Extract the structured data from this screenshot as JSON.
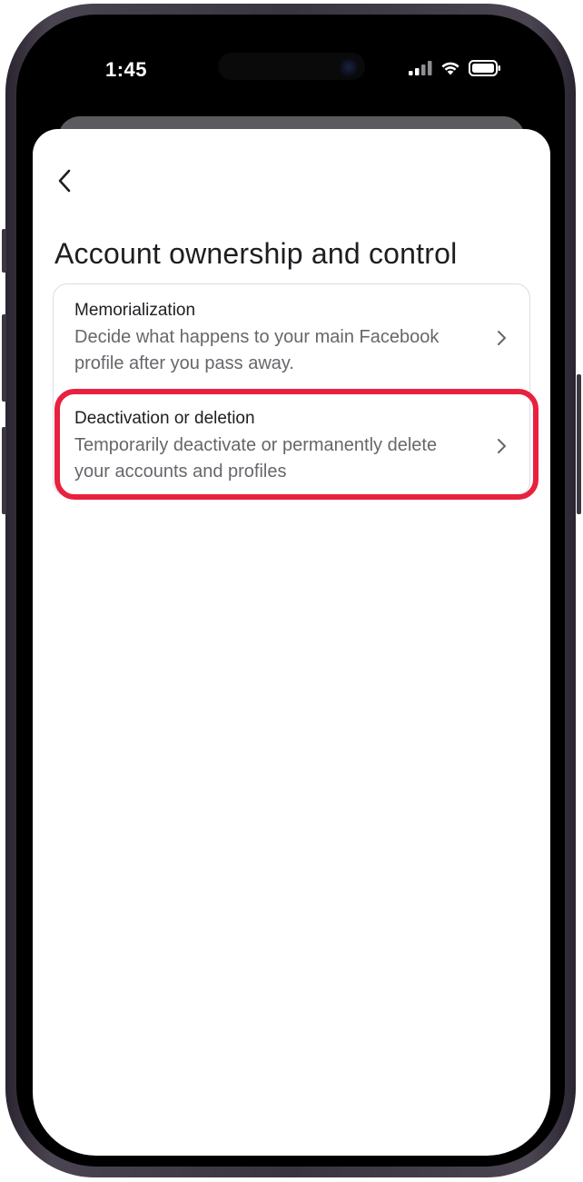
{
  "status_bar": {
    "time": "1:45"
  },
  "page": {
    "title": "Account ownership and control"
  },
  "options": [
    {
      "title": "Memorialization",
      "description": "Decide what happens to your main Facebook profile after you pass away."
    },
    {
      "title": "Deactivation or deletion",
      "description": "Temporarily deactivate or permanently delete your accounts and profiles"
    }
  ],
  "icons": {
    "back": "chevron-left-icon",
    "row_arrow": "chevron-right-icon",
    "signal": "cellular-signal-icon",
    "wifi": "wifi-icon",
    "battery": "battery-icon"
  },
  "colors": {
    "highlight": "#e8213f",
    "primary_text": "#1c1e21",
    "secondary_text": "#65676b",
    "card_border": "#dadde1"
  }
}
